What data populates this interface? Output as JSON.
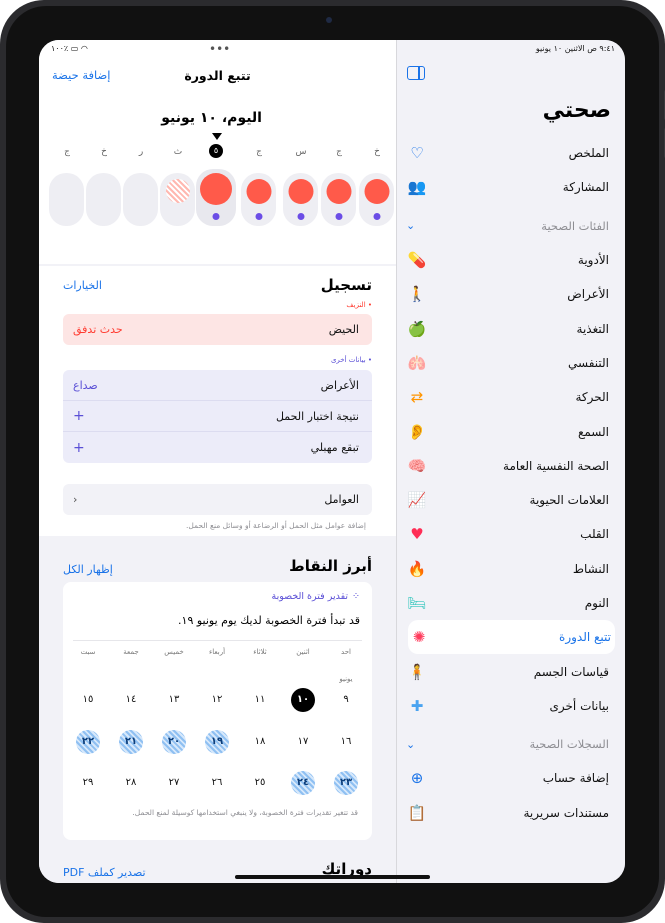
{
  "status": {
    "time": "٩:٤١ ص",
    "date": "الاثنين ١٠ يونيو",
    "battery": "١٠٠٪"
  },
  "sidebar": {
    "title": "صحتي",
    "items": [
      {
        "label": "الملخص",
        "icon": "heart-outline-icon",
        "glyph": "♡",
        "color": "#1a73e8"
      },
      {
        "label": "المشاركة",
        "icon": "people-icon",
        "glyph": "👥",
        "color": "#1a73e8"
      },
      {
        "label": "الفئات الصحية",
        "icon": "chevron-down-icon",
        "glyph": "⌄",
        "section": true
      },
      {
        "label": "الأدوية",
        "icon": "pills-icon",
        "glyph": "💊",
        "color": "#1a73e8"
      },
      {
        "label": "الأعراض",
        "icon": "symptoms-icon",
        "glyph": "🚶",
        "color": "#5a4fd6"
      },
      {
        "label": "التغذية",
        "icon": "apple-icon",
        "glyph": "🍏",
        "color": "#34c759"
      },
      {
        "label": "التنفسي",
        "icon": "lungs-icon",
        "glyph": "🫁",
        "color": "#4aa3f0"
      },
      {
        "label": "الحركة",
        "icon": "arrows-icon",
        "glyph": "⇄",
        "color": "#ff9500"
      },
      {
        "label": "السمع",
        "icon": "ear-icon",
        "glyph": "👂",
        "color": "#1a73e8"
      },
      {
        "label": "الصحة النفسية العامة",
        "icon": "head-icon",
        "glyph": "🧠",
        "color": "#30c2b0"
      },
      {
        "label": "العلامات الحيوية",
        "icon": "vitals-icon",
        "glyph": "📈",
        "color": "#ff3b30"
      },
      {
        "label": "القلب",
        "icon": "heart-icon",
        "glyph": "♥",
        "color": "#ff2d55"
      },
      {
        "label": "النشاط",
        "icon": "flame-icon",
        "glyph": "🔥",
        "color": "#ff6b00"
      },
      {
        "label": "النوم",
        "icon": "bed-icon",
        "glyph": "🛏",
        "color": "#34c7bd"
      },
      {
        "label": "تتبع الدورة",
        "icon": "cycle-icon",
        "glyph": "✺",
        "color": "#ff3b5c",
        "active": true
      },
      {
        "label": "قياسات الجسم",
        "icon": "body-icon",
        "glyph": "🧍",
        "color": "#af52de"
      },
      {
        "label": "بيانات أخرى",
        "icon": "plus-cross-icon",
        "glyph": "✚",
        "color": "#4aa3f0"
      },
      {
        "label": "السجلات الصحية",
        "icon": "chevron-down-icon",
        "glyph": "⌄",
        "section": true
      },
      {
        "label": "إضافة حساب",
        "icon": "plus-circle-icon",
        "glyph": "⊕",
        "color": "#1a73e8"
      },
      {
        "label": "مستندات سريرية",
        "icon": "clipboard-icon",
        "glyph": "📋",
        "color": "#555"
      }
    ]
  },
  "main": {
    "nav_title": "تتبع الدورة",
    "add_period": "إضافة حيضة",
    "date_heading": "اليوم، ١٠ يونيو",
    "days": [
      {
        "letter": "ج",
        "circle": "none"
      },
      {
        "letter": "خ",
        "circle": "none"
      },
      {
        "letter": "ر",
        "circle": "none"
      },
      {
        "letter": "ث",
        "circle": "hatch"
      },
      {
        "letter": "٥",
        "circle": "large",
        "today": true
      },
      {
        "letter": "ج",
        "circle": "full",
        "dot": true
      },
      {
        "letter": "س",
        "circle": "full",
        "dot": true
      },
      {
        "letter": "ج",
        "circle": "full",
        "dot": true
      },
      {
        "letter": "خ",
        "circle": "full",
        "dot": true
      }
    ],
    "log": {
      "title": "تسجيل",
      "options": "الخيارات",
      "bleeding_label": "• النزيف",
      "period_row": {
        "label": "الحيض",
        "value": "حدث تدفق"
      },
      "other_label": "• بيانات أخرى",
      "rows": [
        {
          "label": "الأعراض",
          "value": "صداع"
        },
        {
          "label": "نتيجة اختبار الحمل",
          "value": "+"
        },
        {
          "label": "تبقع مهبلي",
          "value": "+"
        }
      ],
      "factors": "العوامل",
      "factors_note": "إضافة عوامل مثل الحمل أو الرضاعة أو وسائل منع الحمل."
    },
    "highlights": {
      "title": "أبرز النقاط",
      "show_all": "إظهار الكل",
      "fertile_label": "تقدير فترة الخصوبة",
      "fertile_text": "قد تبدأ فترة الخصوبة لديك يوم يونيو ١٩.",
      "weekdays": [
        "احد",
        "اثنين",
        "ثلاثاء",
        "أربعاء",
        "خميس",
        "جمعة",
        "سبت"
      ],
      "month": "يونيو",
      "weeks": [
        [
          "٩",
          "١٠",
          "١١",
          "١٢",
          "١٣",
          "١٤",
          "١٥"
        ],
        [
          "١٦",
          "١٧",
          "١٨",
          "١٩",
          "٢٠",
          "٢١",
          "٢٢"
        ],
        [
          "٢٣",
          "٢٤",
          "٢٥",
          "٢٦",
          "٢٧",
          "٢٨",
          "٢٩"
        ]
      ],
      "fertile_days": [
        "١٩",
        "٢٠",
        "٢١",
        "٢٢",
        "٢٣",
        "٢٤"
      ],
      "today_day": "١٠",
      "disclaimer": "قد تتغير تقديرات فترة الخصوبة، ولا ينبغي استخدامها كوسيلة لمنع الحمل."
    },
    "cycles": {
      "title": "دوراتك",
      "export": "تصدير كملف PDF"
    }
  }
}
